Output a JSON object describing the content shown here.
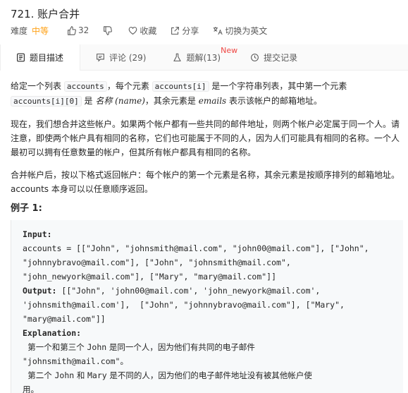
{
  "problem": {
    "title": "721. 账户合并",
    "difficulty_label": "难度",
    "difficulty_value": "中等",
    "likes": "32",
    "favorite_label": "收藏",
    "share_label": "分享",
    "translate_label": "切换为英文"
  },
  "tabs": [
    {
      "label": "题目描述",
      "icon": "document-icon"
    },
    {
      "label": "评论 (29)",
      "icon": "comment-icon"
    },
    {
      "label": "题解(13)",
      "icon": "flask-icon",
      "badge": "New"
    },
    {
      "label": "提交记录",
      "icon": "history-icon"
    }
  ],
  "description": {
    "p1": {
      "a": "给定一个列表 ",
      "code1": "accounts",
      "b": "，每个元素 ",
      "code2": "accounts[i]",
      "c": " 是一个字符串列表，其中第一个元素 ",
      "code3": "accounts[i][0]",
      "d": " 是 ",
      "em1": "名称 (name)",
      "e": "，其余元素是 ",
      "em2": "emails",
      "f": " 表示该帐户的邮箱地址。"
    },
    "p2": "现在，我们想合并这些帐户。如果两个帐户都有一些共同的邮件地址，则两个帐户必定属于同一个人。请注意，即使两个帐户具有相同的名称，它们也可能属于不同的人，因为人们可能具有相同的名称。一个人最初可以拥有任意数量的帐户，但其所有帐户都具有相同的名称。",
    "p3": "合并帐户后，按以下格式返回帐户：每个帐户的第一个元素是名称，其余元素是按顺序排列的邮箱地址。accounts 本身可以以任意顺序返回。",
    "example_title": "例子 1:"
  },
  "example": {
    "input_label": "Input:",
    "lines": [
      "accounts = [[\"John\", \"johnsmith@mail.com\", \"john00@mail.com\"], [\"John\",",
      "\"johnnybravo@mail.com\"], [\"John\", \"johnsmith@mail.com\",",
      "\"john_newyork@mail.com\"], [\"Mary\", \"mary@mail.com\"]]"
    ],
    "output_label": "Output:",
    "output_lines": [
      " [[\"John\", 'john00@mail.com', 'john_newyork@mail.com',",
      "'johnsmith@mail.com'],  [\"John\", \"johnnybravo@mail.com\"], [\"Mary\",",
      "\"mary@mail.com\"]]"
    ],
    "explanation_label": "Explanation:",
    "expl1a": "  第一个和第三个 ",
    "expl1b": "John",
    "expl1c": " 是同一个人，因为他们有共同的电子邮件",
    "expl2": "\"johnsmith@mail.com\"。",
    "expl3a": "  第二个 ",
    "expl3b": "John",
    "expl3c": " 和 ",
    "expl3d": "Mary",
    "expl3e": " 是不同的人，因为他们的电子邮件地址没有被其他帐户使",
    "expl4": "用。"
  },
  "colors": {
    "accent_medium": "#ffa116",
    "new_badge": "#ef4743"
  }
}
